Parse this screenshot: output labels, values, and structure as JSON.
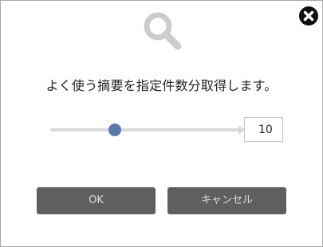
{
  "dialog": {
    "message": "よく使う摘要を指定件数分取得します。",
    "slider": {
      "min": 0,
      "max": 30,
      "value": 10
    },
    "count_value": "10",
    "ok_label": "OK",
    "cancel_label": "キャンセル"
  },
  "icons": {
    "header": "search-icon",
    "close": "close-icon"
  },
  "colors": {
    "button_bg": "#5f5f5f",
    "slider_thumb": "#5b78ae",
    "icon_gray": "#cccccc"
  }
}
